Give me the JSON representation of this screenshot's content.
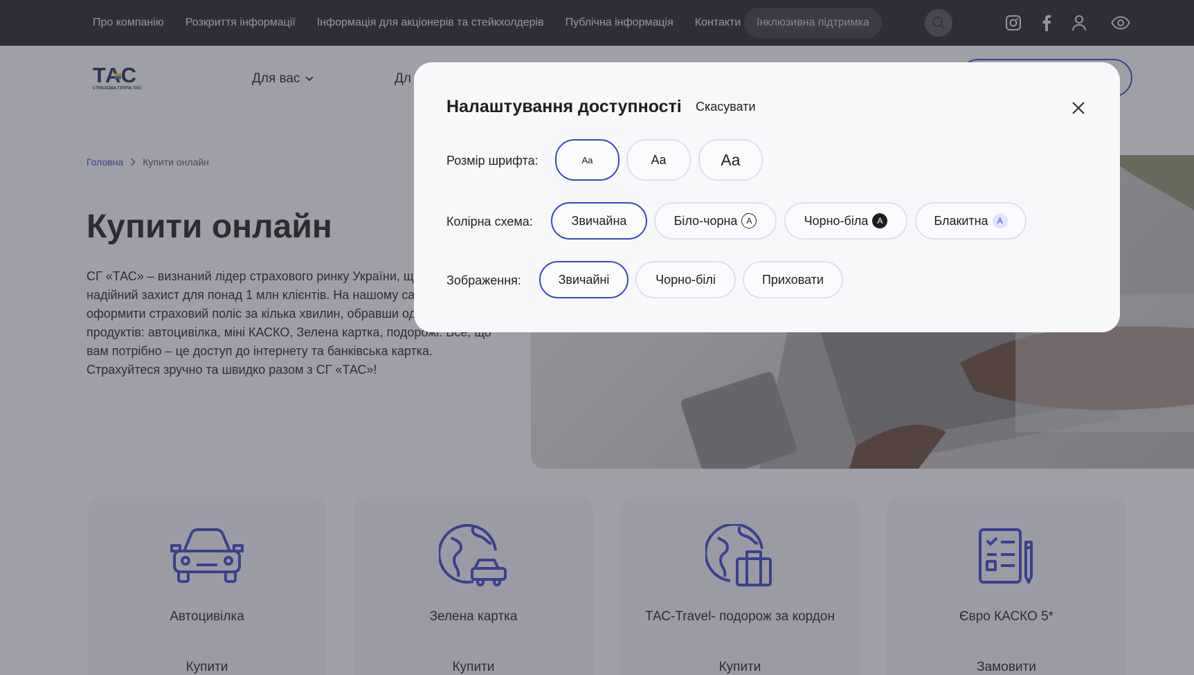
{
  "topbar": {
    "nav": [
      "Про компанію",
      "Розкриття інформації",
      "Інформація для акціонерів та стейкхолдерів",
      "Публічна інформація",
      "Контакти"
    ],
    "support_label": "Інклюзивна підтримка",
    "icons": [
      "search-icon",
      "instagram-icon",
      "facebook-icon",
      "user-icon",
      "eye-icon"
    ]
  },
  "header": {
    "logo_text": "ТАС",
    "logo_subtext": "СТРАХОВА ГРУПА ТАС",
    "nav_for_you": "Для вас",
    "nav_business_partial": "Дл"
  },
  "breadcrumb": {
    "home": "Головна",
    "current": "Купити онлайн"
  },
  "main": {
    "title": "Купити онлайн",
    "intro": "СГ «ТАС» – визнаний лідер страхового ринку України, що забезпечує надійний захист для понад 1 млн клієнтів. На нашому сайті ви можете оформити страховий поліс за кілька хвилин, обравши один з наших продуктів: автоцивілка, міні КАСКО, Зелена картка, подорожі. Все, що вам потрібно – це доступ до інтернету та банківська картка. Страхуйтеся зручно та швидко разом з СГ «ТАС»!"
  },
  "cards": [
    {
      "title": "Автоцивілка",
      "action": "Купити",
      "icon": "car-icon"
    },
    {
      "title": "Зелена картка",
      "action": "Купити",
      "icon": "globe-car-icon"
    },
    {
      "title": "ТАС-Travel- подорож за кордон",
      "action": "Купити",
      "icon": "globe-luggage-icon"
    },
    {
      "title": "Євро КАСКО 5*",
      "action": "Замовити",
      "icon": "checklist-icon"
    }
  ],
  "modal": {
    "title": "Налаштування доступності",
    "cancel": "Скасувати",
    "font_size_label": "Розмір шрифта:",
    "font_sizes": [
      "Aa",
      "Aa",
      "Aa"
    ],
    "font_size_selected": 0,
    "color_scheme_label": "Колірна схема:",
    "color_schemes": [
      "Звичайна",
      "Біло-чорна",
      "Чорно-біла",
      "Блакитна"
    ],
    "color_scheme_badge": "A",
    "color_scheme_selected": 0,
    "images_label": "Зображення:",
    "images_options": [
      "Звичайні",
      "Чорно-білі",
      "Приховати"
    ],
    "images_selected": 0,
    "colors": {
      "accent": "#3845c8",
      "border": "#dcdff1",
      "dark": "#1e1e1e",
      "blue_badge": "#dfe4ff"
    }
  }
}
